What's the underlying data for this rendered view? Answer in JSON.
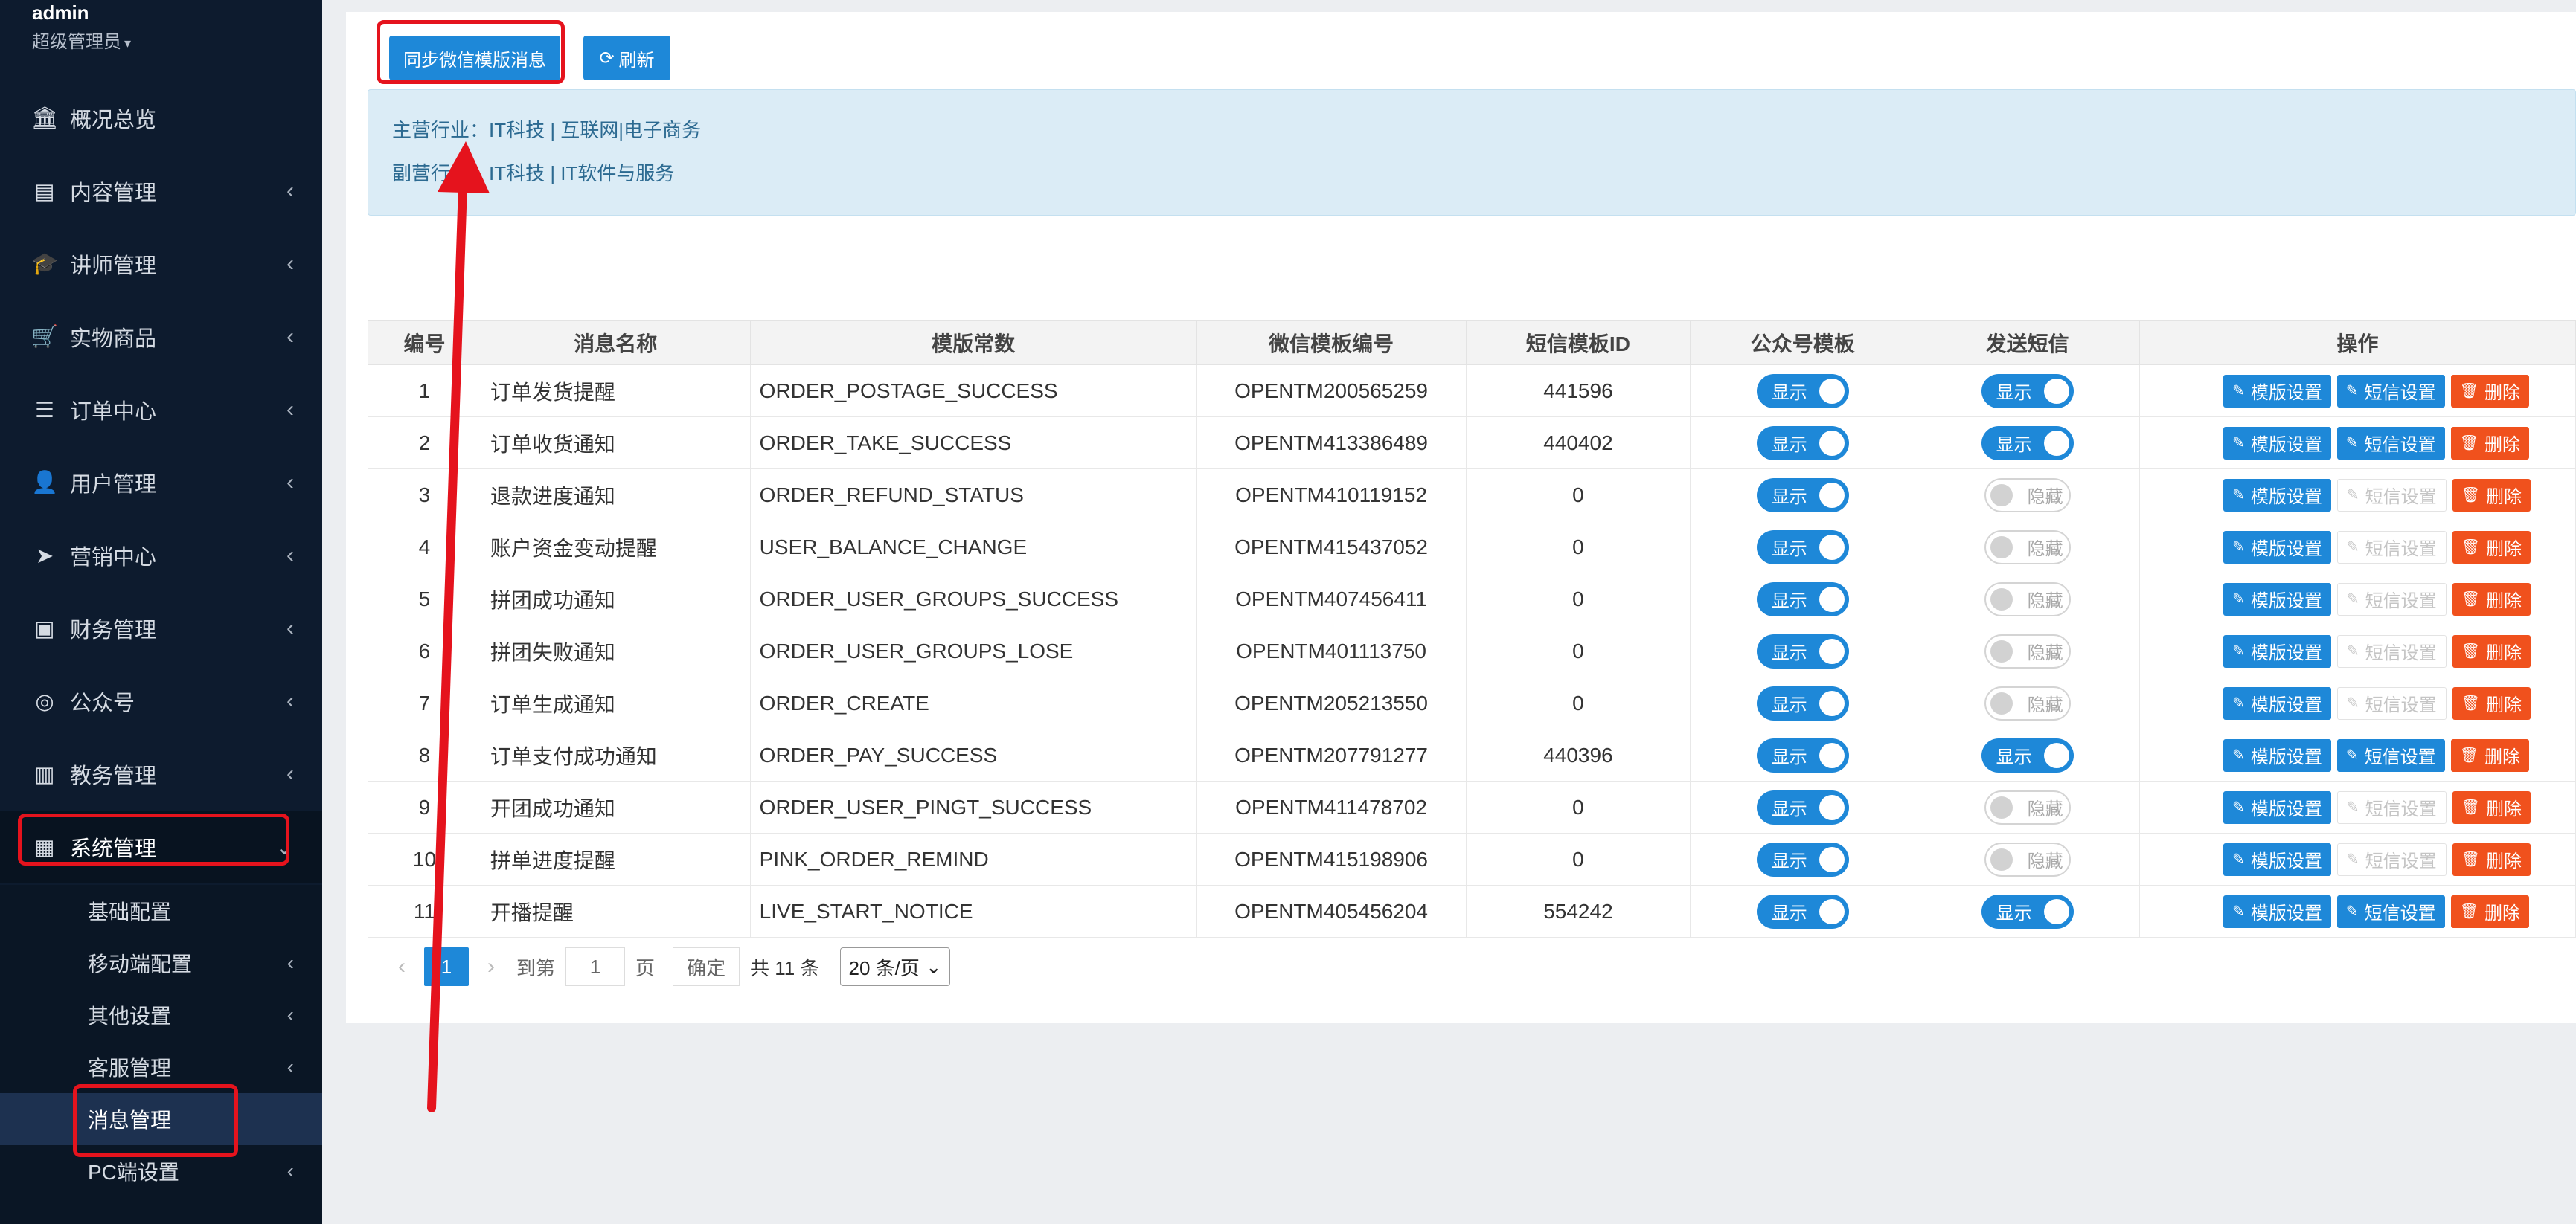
{
  "user": {
    "name": "admin",
    "role": "超级管理员"
  },
  "menu": [
    {
      "label": "概况总览",
      "icon": "bank-icon",
      "arrow": false
    },
    {
      "label": "内容管理",
      "icon": "newspaper-icon",
      "arrow": true
    },
    {
      "label": "讲师管理",
      "icon": "graduation-cap-icon",
      "arrow": true
    },
    {
      "label": "实物商品",
      "icon": "cart-icon",
      "arrow": true
    },
    {
      "label": "订单中心",
      "icon": "list-icon",
      "arrow": true
    },
    {
      "label": "用户管理",
      "icon": "user-icon",
      "arrow": true
    },
    {
      "label": "营销中心",
      "icon": "paper-plane-icon",
      "arrow": true
    },
    {
      "label": "财务管理",
      "icon": "money-icon",
      "arrow": true
    },
    {
      "label": "公众号",
      "icon": "wechat-icon",
      "arrow": true
    },
    {
      "label": "教务管理",
      "icon": "book-icon",
      "arrow": true
    },
    {
      "label": "系统管理",
      "icon": "grid-icon",
      "arrow": true
    }
  ],
  "submenu": [
    {
      "label": "基础配置",
      "arrow": false
    },
    {
      "label": "移动端配置",
      "arrow": true
    },
    {
      "label": "其他设置",
      "arrow": true
    },
    {
      "label": "客服管理",
      "arrow": true
    },
    {
      "label": "消息管理",
      "arrow": false
    },
    {
      "label": "PC端设置",
      "arrow": true
    }
  ],
  "toolbar": {
    "sync_label": "同步微信模版消息",
    "refresh_label": "刷新"
  },
  "info": {
    "main_industry": "主营行业：IT科技 | 互联网|电子商务",
    "sub_industry": "副营行业：IT科技 | IT软件与服务"
  },
  "table": {
    "headers": [
      "编号",
      "消息名称",
      "模版常数",
      "微信模板编号",
      "短信模板ID",
      "公众号模板",
      "发送短信",
      "操作"
    ],
    "switch_on": "显示",
    "switch_off": "隐藏",
    "op_template": "模版设置",
    "op_sms": "短信设置",
    "op_delete": "删除",
    "rows": [
      {
        "id": "1",
        "name": "订单发货提醒",
        "const": "ORDER_POSTAGE_SUCCESS",
        "wx": "OPENTM200565259",
        "sms": "441596",
        "mp": true,
        "send": true
      },
      {
        "id": "2",
        "name": "订单收货通知",
        "const": "ORDER_TAKE_SUCCESS",
        "wx": "OPENTM413386489",
        "sms": "440402",
        "mp": true,
        "send": true
      },
      {
        "id": "3",
        "name": "退款进度通知",
        "const": "ORDER_REFUND_STATUS",
        "wx": "OPENTM410119152",
        "sms": "0",
        "mp": true,
        "send": false
      },
      {
        "id": "4",
        "name": "账户资金变动提醒",
        "const": "USER_BALANCE_CHANGE",
        "wx": "OPENTM415437052",
        "sms": "0",
        "mp": true,
        "send": false
      },
      {
        "id": "5",
        "name": "拼团成功通知",
        "const": "ORDER_USER_GROUPS_SUCCESS",
        "wx": "OPENTM407456411",
        "sms": "0",
        "mp": true,
        "send": false
      },
      {
        "id": "6",
        "name": "拼团失败通知",
        "const": "ORDER_USER_GROUPS_LOSE",
        "wx": "OPENTM401113750",
        "sms": "0",
        "mp": true,
        "send": false
      },
      {
        "id": "7",
        "name": "订单生成通知",
        "const": "ORDER_CREATE",
        "wx": "OPENTM205213550",
        "sms": "0",
        "mp": true,
        "send": false
      },
      {
        "id": "8",
        "name": "订单支付成功通知",
        "const": "ORDER_PAY_SUCCESS",
        "wx": "OPENTM207791277",
        "sms": "440396",
        "mp": true,
        "send": true
      },
      {
        "id": "9",
        "name": "开团成功通知",
        "const": "ORDER_USER_PINGT_SUCCESS",
        "wx": "OPENTM411478702",
        "sms": "0",
        "mp": true,
        "send": false
      },
      {
        "id": "10",
        "name": "拼单进度提醒",
        "const": "PINK_ORDER_REMIND",
        "wx": "OPENTM415198906",
        "sms": "0",
        "mp": true,
        "send": false
      },
      {
        "id": "11",
        "name": "开播提醒",
        "const": "LIVE_START_NOTICE",
        "wx": "OPENTM405456204",
        "sms": "554242",
        "mp": true,
        "send": true
      }
    ]
  },
  "pager": {
    "current": "1",
    "goto_label": "到第",
    "goto_value": "1",
    "page_label": "页",
    "ok_label": "确定",
    "total_label": "共 11 条",
    "page_size": "20 条/页"
  }
}
